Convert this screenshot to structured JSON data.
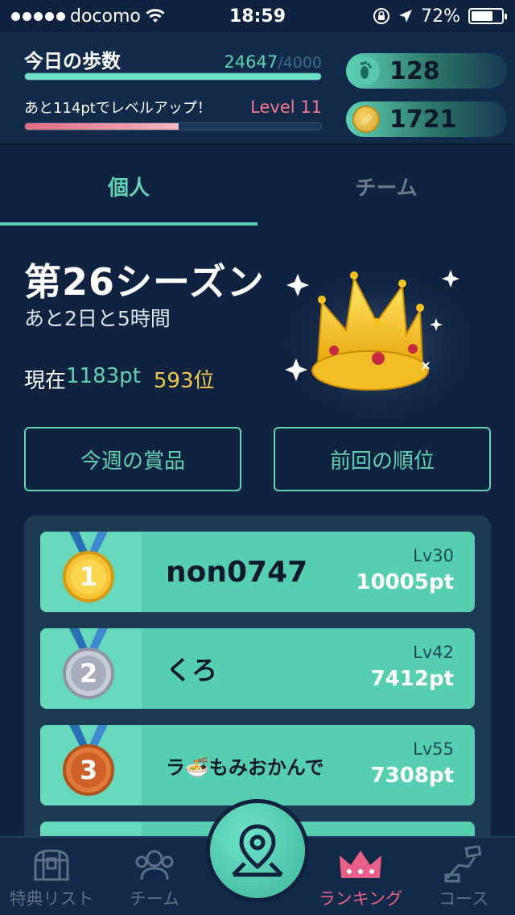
{
  "status_bar": {
    "carrier": "docomo",
    "time": "18:59",
    "battery": "72%",
    "battery_level": 0.72
  },
  "header": {
    "steps_title": "今日の歩数",
    "steps_value": "24647",
    "steps_goal": "/4000",
    "steps_progress": 1.0,
    "level_text": "あと114ptでレベルアップ！",
    "level_label": "Level 11",
    "level_progress": 0.52,
    "footsteps_count": "128",
    "coins_count": "1721"
  },
  "tabs": [
    {
      "label": "個人",
      "active": true
    },
    {
      "label": "チーム",
      "active": false
    }
  ],
  "season": {
    "title": "第26シーズン",
    "remaining": "あと2日と5時間",
    "current_label": "現在",
    "current_points": "1183pt",
    "current_rank": "593位"
  },
  "buttons": {
    "prizes": "今週の賞品",
    "previous_rank": "前回の順位"
  },
  "ranking": [
    {
      "rank": "1",
      "name": "non0747",
      "level": "Lv30",
      "points": "10005pt",
      "medal": "gold"
    },
    {
      "rank": "2",
      "name": "くろ",
      "level": "Lv42",
      "points": "7412pt",
      "medal": "silver"
    },
    {
      "rank": "3",
      "name": "ラ🍜もみおかんで",
      "level": "Lv55",
      "points": "7308pt",
      "medal": "bronze"
    }
  ],
  "bottom_nav": {
    "items": [
      {
        "label": "特典リスト",
        "icon": "treasure-chest-icon",
        "active": false
      },
      {
        "label": "チーム",
        "icon": "team-icon",
        "active": false
      },
      {
        "label": "ランキング",
        "icon": "crown-icon",
        "active": true
      },
      {
        "label": "コース",
        "icon": "course-icon",
        "active": false
      }
    ],
    "center_icon": "map-pin-icon"
  },
  "colors": {
    "background": "#0f2340",
    "accent": "#5fd2b4",
    "rank_color": "#f2c94c",
    "level_color": "#f07a8a",
    "active_nav": "#ea5f86"
  }
}
